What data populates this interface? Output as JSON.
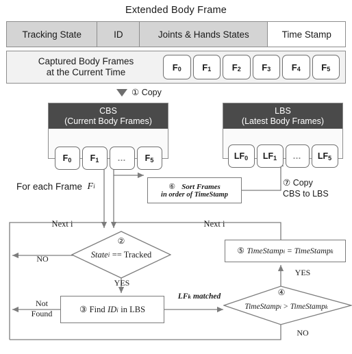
{
  "title": "Extended Body Frame",
  "header_table": {
    "columns": [
      {
        "label": "Tracking State",
        "highlight": "#d4d4d4"
      },
      {
        "label": "ID",
        "highlight": "#d4d4d4"
      },
      {
        "label": "Joints & Hands States",
        "highlight": "#d4d4d4"
      },
      {
        "label": "Time Stamp",
        "highlight": "#ffffff"
      }
    ]
  },
  "captured": {
    "label_line1": "Captured Body Frames",
    "label_line2": "at the Current Time",
    "frames": [
      {
        "base": "F",
        "sub": "0"
      },
      {
        "base": "F",
        "sub": "1"
      },
      {
        "base": "F",
        "sub": "2"
      },
      {
        "base": "F",
        "sub": "3"
      },
      {
        "base": "F",
        "sub": "4"
      },
      {
        "base": "F",
        "sub": "5"
      }
    ]
  },
  "copy_step": {
    "marker": "①",
    "label": "Copy"
  },
  "cbs": {
    "title": "CBS",
    "subtitle": "(Current Body Frames)",
    "frames": [
      {
        "base": "F",
        "sub": "0"
      },
      {
        "base": "F",
        "sub": "1"
      },
      {
        "base": "…",
        "sub": ""
      },
      {
        "base": "F",
        "sub": "5"
      }
    ]
  },
  "lbs": {
    "title": "LBS",
    "subtitle": "(Latest Body Frames)",
    "frames": [
      {
        "base": "LF",
        "sub": "0"
      },
      {
        "base": "LF",
        "sub": "1"
      },
      {
        "base": "…",
        "sub": ""
      },
      {
        "base": "LF",
        "sub": "5"
      }
    ]
  },
  "for_each": {
    "text": "For each Frame",
    "variable": "F",
    "sub": "i"
  },
  "sort_step": {
    "marker": "⑥",
    "line1": "Sort Frames",
    "line2": "in order of TimeStamp"
  },
  "copy_cbs_lbs": {
    "marker": "⑦",
    "line1": "Copy",
    "line2": "CBS to LBS"
  },
  "decision_state": {
    "marker": "②",
    "expr_var": "State",
    "expr_sub": "i",
    "expr_op": "== Tracked",
    "yes_label": "YES",
    "no_label": "NO"
  },
  "find_step": {
    "marker": "③",
    "text_pre": "Find",
    "id_var": "ID",
    "id_sub": "i",
    "text_post": "in LBS",
    "not_found_line1": "Not",
    "not_found_line2": "Found"
  },
  "matched_label": {
    "var": "LF",
    "sub": "k",
    "text": "matched"
  },
  "decision_timestamp": {
    "marker": "④",
    "left_var": "TimeStamp",
    "left_sub": "i",
    "op": ">",
    "right_var": "TimeStamp",
    "right_sub": "k",
    "yes_label": "YES",
    "no_label": "NO"
  },
  "assign_step": {
    "marker": "⑤",
    "left_var": "TimeStamp",
    "left_sub": "i",
    "op": "=",
    "right_var": "TimeStamp",
    "right_sub": "k"
  },
  "loop_labels": {
    "next_left": "Next i",
    "next_right": "Next i"
  },
  "colors": {
    "store_header_bg": "#4a4a4a",
    "table_fill": "#d4d4d4",
    "line": "#7d7d7d",
    "panel_fill": "#f2f2f2"
  }
}
